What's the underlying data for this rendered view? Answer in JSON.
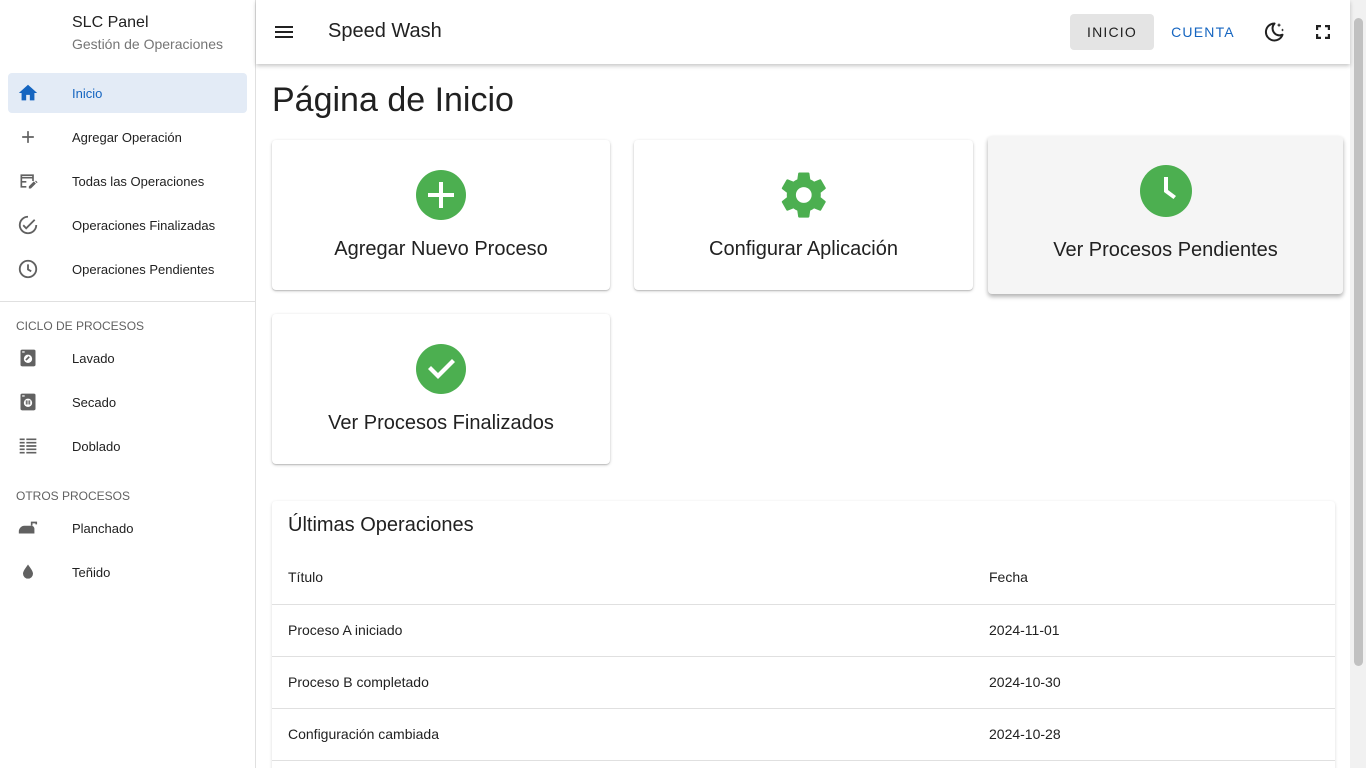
{
  "sidebar": {
    "brand_title": "SLC Panel",
    "brand_subtitle": "Gestión de Operaciones",
    "items": [
      {
        "label": "Inicio",
        "icon": "home-icon",
        "active": true
      },
      {
        "label": "Agregar Operación",
        "icon": "plus-icon"
      },
      {
        "label": "Todas las Operaciones",
        "icon": "table-edit-icon"
      },
      {
        "label": "Operaciones Finalizadas",
        "icon": "check-circle-outline-icon"
      },
      {
        "label": "Operaciones Pendientes",
        "icon": "clock-outline-icon"
      }
    ],
    "section1": {
      "title": "CICLO DE PROCESOS",
      "items": [
        {
          "label": "Lavado",
          "icon": "washing-machine-icon"
        },
        {
          "label": "Secado",
          "icon": "dryer-icon"
        },
        {
          "label": "Doblado",
          "icon": "folded-list-icon"
        }
      ]
    },
    "section2": {
      "title": "OTROS PROCESOS",
      "items": [
        {
          "label": "Planchado",
          "icon": "iron-icon"
        },
        {
          "label": "Teñido",
          "icon": "water-drop-icon"
        }
      ]
    }
  },
  "topbar": {
    "title": "Speed Wash",
    "inicio_label": "INICIO",
    "cuenta_label": "CUENTA",
    "accent": "#1565c0"
  },
  "main": {
    "page_title": "Página de Inicio",
    "cards": [
      {
        "label": "Agregar Nuevo Proceso",
        "icon": "plus-circle-icon"
      },
      {
        "label": "Configurar Aplicación",
        "icon": "gear-icon"
      },
      {
        "label": "Ver Procesos Pendientes",
        "icon": "clock-icon"
      },
      {
        "label": "Ver Procesos Finalizados",
        "icon": "check-circle-icon"
      }
    ],
    "icon_color": "#4caf50",
    "recent": {
      "title": "Últimas Operaciones",
      "columns": [
        "Título",
        "Fecha"
      ],
      "rows": [
        [
          "Proceso A iniciado",
          "2024-11-01"
        ],
        [
          "Proceso B completado",
          "2024-10-30"
        ],
        [
          "Configuración cambiada",
          "2024-10-28"
        ]
      ]
    }
  }
}
